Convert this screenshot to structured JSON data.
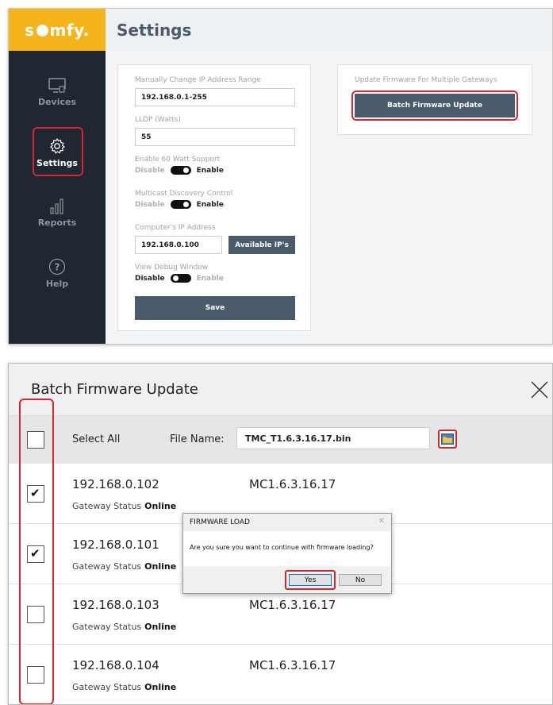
{
  "top": {
    "brand": {
      "logo_text_before": "s",
      "logo_text_after": "mfy."
    },
    "header": {
      "title": "Settings"
    },
    "sidebar": {
      "items": [
        {
          "label": "Devices",
          "icon": "monitor-icon",
          "active": false
        },
        {
          "label": "Settings",
          "icon": "gear-icon",
          "active": true
        },
        {
          "label": "Reports",
          "icon": "bar-chart-icon",
          "active": false
        },
        {
          "label": "Help",
          "icon": "question-icon",
          "active": false
        }
      ]
    },
    "settings_form": {
      "ip_range_label": "Manually Change IP Address Range",
      "ip_range_value": "192.168.0.1-255",
      "lldp_label": "LLDP (Watts)",
      "lldp_value": "55",
      "sixty_watt_label": "Enable 60 Watt Support",
      "sixty_watt": {
        "off_label": "Disable",
        "on_label": "Enable",
        "state": "enabled"
      },
      "multicast_label": "Multicast Discovery Control",
      "multicast": {
        "off_label": "Disable",
        "on_label": "Enable",
        "state": "enabled"
      },
      "computer_ip_label": "Computer's IP Address",
      "computer_ip_value": "192.168.0.100",
      "available_ips_button": "Available IP's",
      "debug_label": "View Debug Window",
      "debug": {
        "off_label": "Disable",
        "on_label": "Enable",
        "state": "disabled"
      },
      "save_button": "Save"
    },
    "firmware_card": {
      "label": "Update Firmware For Multiple Gateways",
      "batch_button": "Batch Firmware Update"
    }
  },
  "dialog": {
    "title": "Batch Firmware Update",
    "select_all_label": "Select All",
    "file_name_label": "File Name:",
    "file_name_value": "TMC_T1.6.3.16.17.bin",
    "gateways": [
      {
        "ip": "192.168.0.102",
        "status_label": "Gateway Status",
        "status": "Online",
        "firmware": "MC1.6.3.16.17",
        "checked": true
      },
      {
        "ip": "192.168.0.101",
        "status_label": "Gateway Status",
        "status": "Online",
        "firmware": "",
        "checked": true
      },
      {
        "ip": "192.168.0.103",
        "status_label": "Gateway Status",
        "status": "Online",
        "firmware": "MC1.6.3.16.17",
        "checked": false
      },
      {
        "ip": "192.168.0.104",
        "status_label": "Gateway Status",
        "status": "Online",
        "firmware": "MC1.6.3.16.17",
        "checked": false
      }
    ]
  },
  "modal": {
    "title": "FIRMWARE LOAD",
    "question": "Are you sure you want to continue with firmware loading?",
    "yes_label": "Yes",
    "no_label": "No"
  },
  "colors": {
    "brand": "#f5b41c",
    "sidebar": "#1f2830",
    "button": "#4a5b6b",
    "highlight": "#d8262e"
  }
}
